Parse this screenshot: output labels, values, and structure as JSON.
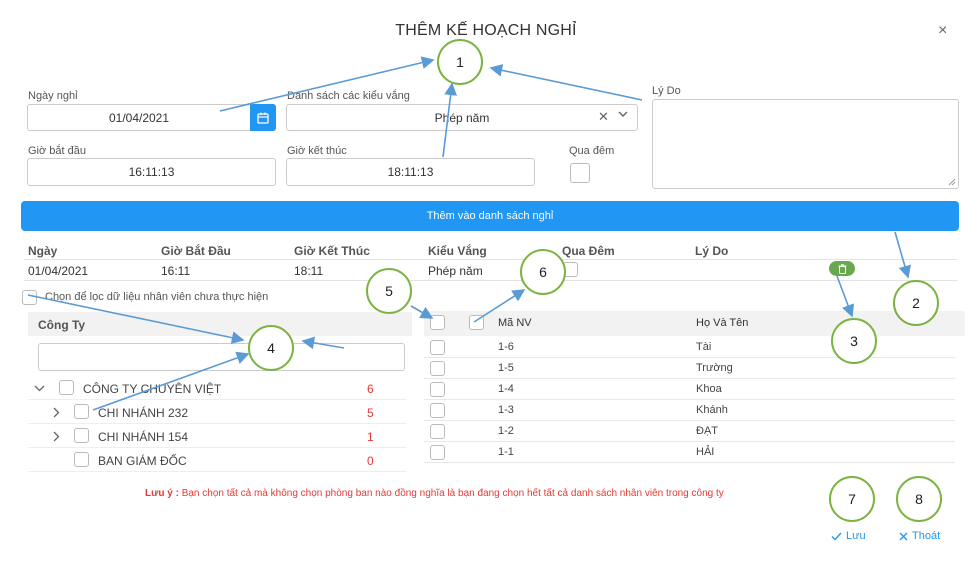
{
  "dialog": {
    "title": "THÊM KẾ HOẠCH NGHỈ",
    "close": "×"
  },
  "form": {
    "ngay_nghi_label": "Ngày nghỉ",
    "ngay_nghi_value": "01/04/2021",
    "kieu_vang_label": "Danh sách các kiểu vắng",
    "kieu_vang_value": "Phép năm",
    "ly_do_label": "Lý Do",
    "gio_bat_dau_label": "Giờ bắt đầu",
    "gio_bat_dau_value": "16:11:13",
    "gio_ket_thuc_label": "Giờ kết thúc",
    "gio_ket_thuc_value": "18:11:13",
    "qua_dem_label": "Qua đêm",
    "add_button": "Thêm vào danh sách nghỉ"
  },
  "leave_table": {
    "headers": [
      "Ngày",
      "Giờ Bắt Đầu",
      "Giờ Kết Thúc",
      "Kiểu Vắng",
      "Qua Đêm",
      "Lý Do"
    ],
    "rows": [
      {
        "ngay": "01/04/2021",
        "bat_dau": "16:11",
        "ket_thuc": "18:11",
        "kieu_vang": "Phép năm"
      }
    ]
  },
  "filter": {
    "label": "Chọn để lọc dữ liệu nhân viên chưa thực hiện"
  },
  "company": {
    "header": "Công Ty",
    "search_value": "",
    "tree": [
      {
        "name": "CÔNG TY CHUYÊN VIỆT",
        "count": "6"
      },
      {
        "name": "CHI NHÁNH 232",
        "count": "5"
      },
      {
        "name": "CHI NHÁNH 154",
        "count": "1"
      },
      {
        "name": "BAN GIÁM ĐỐC",
        "count": "0"
      }
    ]
  },
  "employees": {
    "headers": {
      "ma_nv": "Mã NV",
      "ho_ten": "Họ Và Tên"
    },
    "rows": [
      {
        "ma_nv": "1-6",
        "ho_ten": "Tài"
      },
      {
        "ma_nv": "1-5",
        "ho_ten": "Trường"
      },
      {
        "ma_nv": "1-4",
        "ho_ten": "Khoa"
      },
      {
        "ma_nv": "1-3",
        "ho_ten": "Khánh"
      },
      {
        "ma_nv": "1-2",
        "ho_ten": "ĐẠT"
      },
      {
        "ma_nv": "1-1",
        "ho_ten": "HẢI"
      }
    ]
  },
  "note": {
    "prefix": "Lưu ý :",
    "text": "Bạn chọn tất cả mà không chọn phòng ban nào đồng nghĩa là bạn đang chọn hết tất cả danh sách nhân viên trong công ty"
  },
  "footer": {
    "save": "Lưu",
    "exit": "Thoát"
  },
  "callouts": [
    "1",
    "2",
    "3",
    "4",
    "5",
    "6",
    "7",
    "8"
  ],
  "colors": {
    "accent": "#2196f3",
    "callout_border": "#7cb342",
    "arrow": "#5b9bd5",
    "danger": "#e53935"
  }
}
